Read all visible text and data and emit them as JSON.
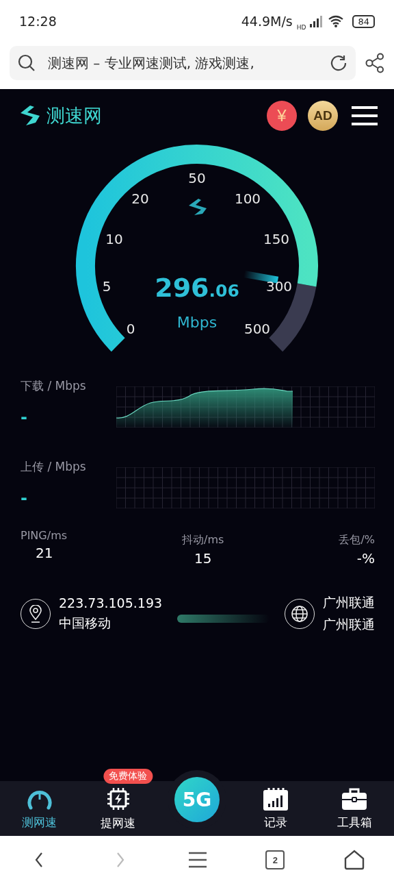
{
  "status_bar": {
    "time": "12:28",
    "speed": "44.9M/s",
    "network": "HD",
    "battery": "84"
  },
  "browser_bar": {
    "url": "测速网 – 专业网速测试, 游戏测速,"
  },
  "header": {
    "logo": "测速网",
    "coin_badge": "¥",
    "ad_badge": "AD"
  },
  "gauge": {
    "ticks": [
      "0",
      "5",
      "10",
      "20",
      "50",
      "100",
      "150",
      "300",
      "500"
    ],
    "value": "296",
    "decimals": ".06",
    "unit": "Mbps"
  },
  "download": {
    "label": "下载 / Mbps",
    "value": "-"
  },
  "upload": {
    "label": "上传 / Mbps",
    "value": "-"
  },
  "stats": [
    {
      "label": "PING/ms",
      "value": "21"
    },
    {
      "label": "抖动/ms",
      "value": "15"
    },
    {
      "label": "丢包/%",
      "value": "-%"
    }
  ],
  "connection": {
    "ip": "223.73.105.193",
    "isp": "中国移动",
    "server_city": "广州联通",
    "server_isp": "广州联通"
  },
  "tab_bar": [
    {
      "kind": "gauge",
      "label": "测网速",
      "selected": true
    },
    {
      "kind": "chip",
      "label": "提网速",
      "selected": false,
      "badge": "免费体验"
    },
    {
      "kind": "center",
      "label": "5G",
      "selected": false
    },
    {
      "kind": "records",
      "label": "记录",
      "selected": false
    },
    {
      "kind": "toolbox",
      "label": "工具箱",
      "selected": false
    }
  ],
  "nav_bar": {
    "back_disabled": false,
    "forward_disabled": true,
    "tab_count": "2"
  }
}
